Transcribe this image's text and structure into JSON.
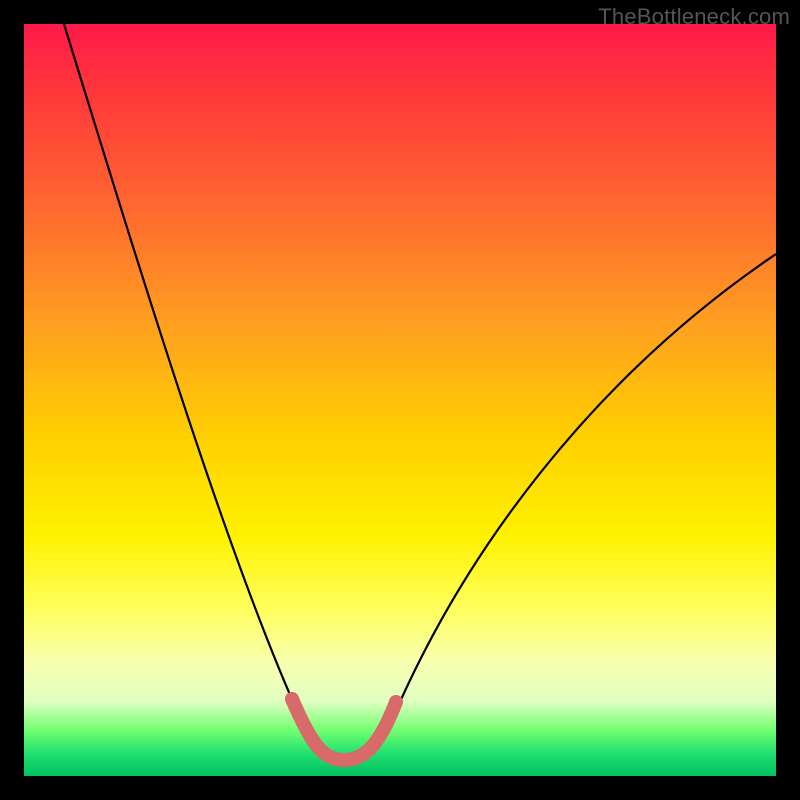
{
  "credit": "TheBottleneck.com",
  "chart_data": {
    "type": "line",
    "title": "",
    "xlabel": "",
    "ylabel": "",
    "series": [
      {
        "name": "bottleneck-curve",
        "x": [
          0.0,
          0.05,
          0.1,
          0.15,
          0.2,
          0.25,
          0.3,
          0.35,
          0.38,
          0.4,
          0.42,
          0.45,
          0.48,
          0.5,
          0.55,
          0.6,
          0.65,
          0.7,
          0.75,
          0.8,
          0.85,
          0.9,
          0.95,
          1.0
        ],
        "values": [
          1.0,
          0.89,
          0.78,
          0.67,
          0.56,
          0.45,
          0.33,
          0.19,
          0.09,
          0.03,
          0.02,
          0.02,
          0.03,
          0.07,
          0.17,
          0.26,
          0.34,
          0.41,
          0.47,
          0.53,
          0.58,
          0.62,
          0.66,
          0.7
        ]
      }
    ],
    "xlim": [
      0,
      1
    ],
    "ylim": [
      0,
      1
    ],
    "highlight": {
      "name": "min-zone",
      "x_range": [
        0.37,
        0.49
      ],
      "y": 0.02
    }
  }
}
